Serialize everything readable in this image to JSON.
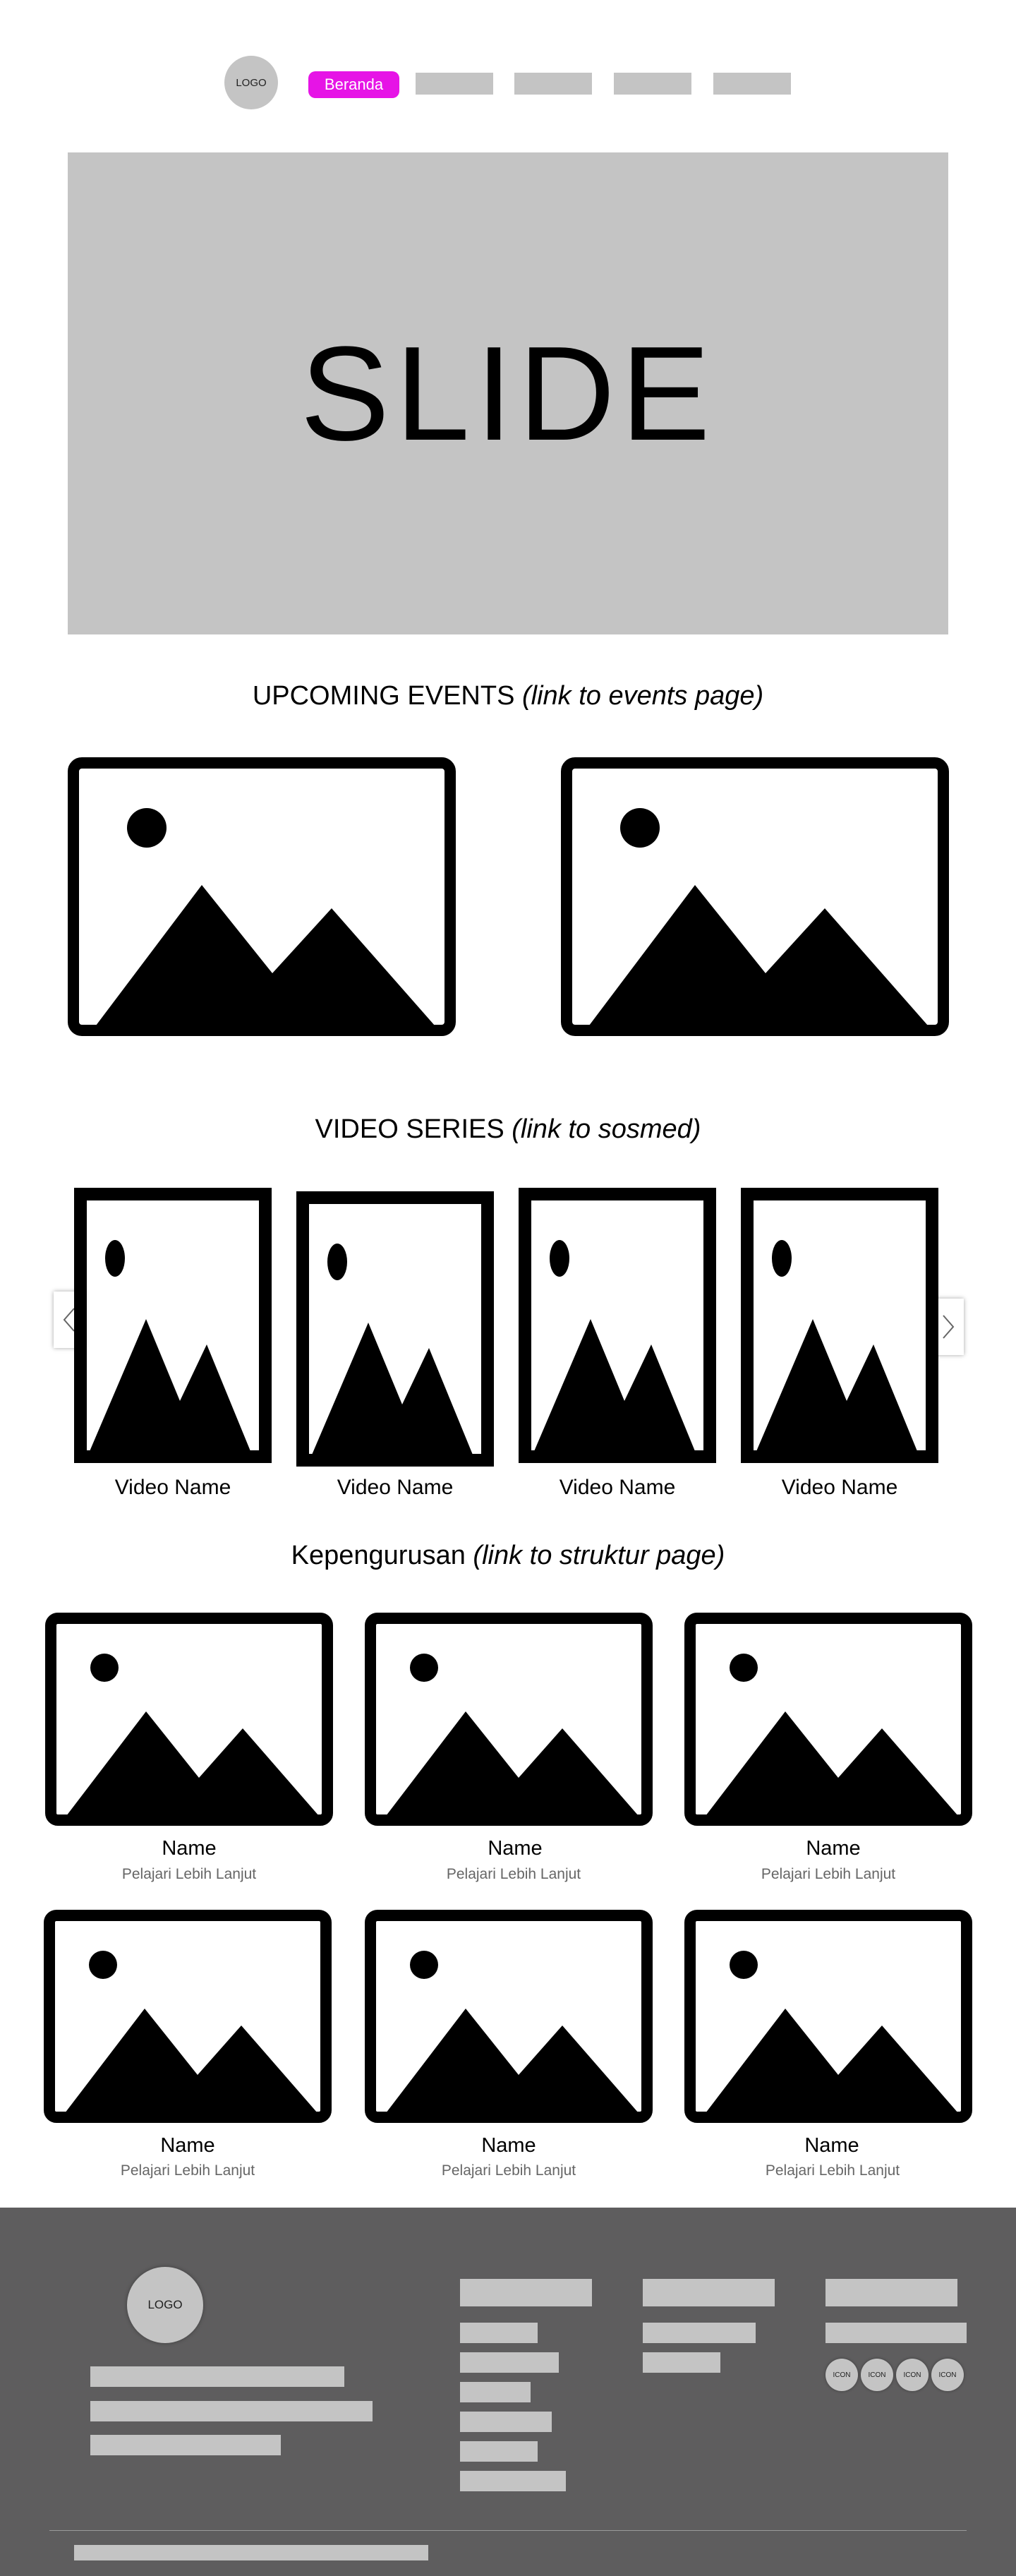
{
  "header": {
    "logo_text": "LOGO",
    "nav_active_label": "Beranda",
    "nav_active_color": "#e614e6"
  },
  "slide": {
    "text": "SLIDE"
  },
  "upcoming_events": {
    "title": "UPCOMING EVENTS ",
    "title_italic": "(link to events page)"
  },
  "video_series": {
    "title": "VIDEO SERIES ",
    "title_italic": "(link to sosmed)",
    "prev_icon": "chevron-left-icon",
    "next_icon": "chevron-right-icon",
    "videos": [
      {
        "name": "Video Name"
      },
      {
        "name": "Video Name"
      },
      {
        "name": "Video Name"
      },
      {
        "name": "Video Name"
      }
    ]
  },
  "kepengurusan": {
    "title": "Kepengurusan ",
    "title_italic": "(link to struktur page)",
    "members": [
      {
        "name": "Name",
        "link": "Pelajari Lebih Lanjut"
      },
      {
        "name": "Name",
        "link": "Pelajari Lebih Lanjut"
      },
      {
        "name": "Name",
        "link": "Pelajari Lebih Lanjut"
      },
      {
        "name": "Name",
        "link": "Pelajari Lebih Lanjut"
      },
      {
        "name": "Name",
        "link": "Pelajari Lebih Lanjut"
      },
      {
        "name": "Name",
        "link": "Pelajari Lebih Lanjut"
      }
    ]
  },
  "footer": {
    "logo_text": "LOGO",
    "icons": [
      "ICON",
      "ICON",
      "ICON",
      "ICON"
    ],
    "background_color": "#5e5d5e"
  }
}
